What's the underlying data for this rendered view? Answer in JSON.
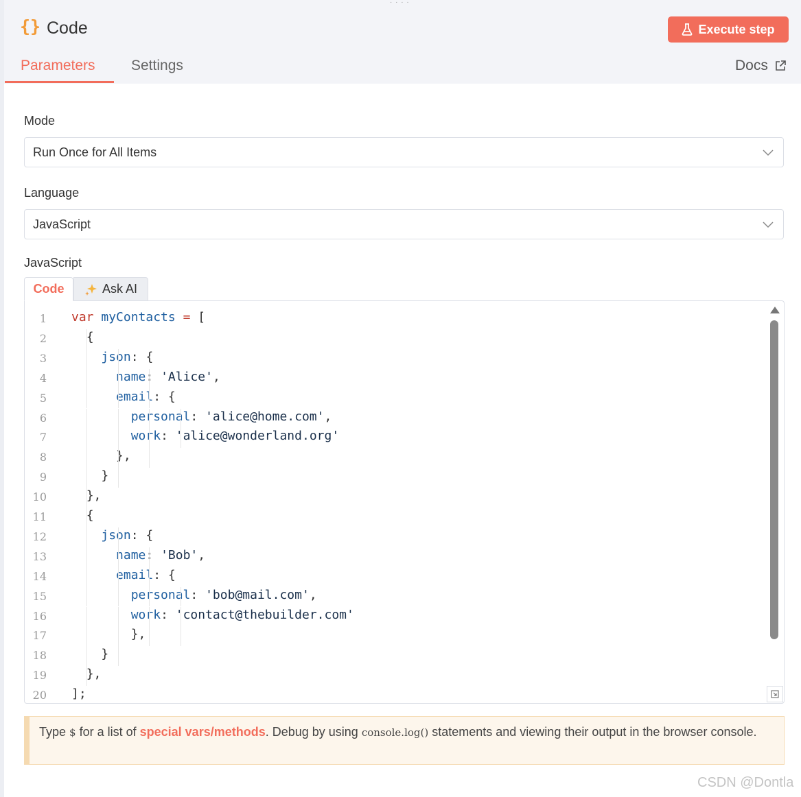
{
  "header": {
    "icon": "braces-icon",
    "title": "Code",
    "execute_label": "Execute step",
    "tabs": [
      {
        "label": "Parameters",
        "active": true
      },
      {
        "label": "Settings",
        "active": false
      }
    ],
    "docs_label": "Docs"
  },
  "form": {
    "mode_label": "Mode",
    "mode_value": "Run Once for All Items",
    "language_label": "Language",
    "language_value": "JavaScript",
    "editor_label": "JavaScript",
    "editor_tabs": [
      {
        "label": "Code",
        "active": true
      },
      {
        "label": "Ask AI",
        "active": false
      }
    ]
  },
  "code_lines": [
    {
      "n": "1",
      "text": "var myContacts = ["
    },
    {
      "n": "2",
      "text": "  {"
    },
    {
      "n": "3",
      "text": "    json: {"
    },
    {
      "n": "4",
      "text": "      name: 'Alice',"
    },
    {
      "n": "5",
      "text": "      email: {"
    },
    {
      "n": "6",
      "text": "        personal: 'alice@home.com',"
    },
    {
      "n": "7",
      "text": "        work: 'alice@wonderland.org'"
    },
    {
      "n": "8",
      "text": "      },"
    },
    {
      "n": "9",
      "text": "    }"
    },
    {
      "n": "10",
      "text": "  },"
    },
    {
      "n": "11",
      "text": "  {"
    },
    {
      "n": "12",
      "text": "    json: {"
    },
    {
      "n": "13",
      "text": "      name: 'Bob',"
    },
    {
      "n": "14",
      "text": "      email: {"
    },
    {
      "n": "15",
      "text": "        personal: 'bob@mail.com',"
    },
    {
      "n": "16",
      "text": "        work: 'contact@thebuilder.com'"
    },
    {
      "n": "17",
      "text": "        },"
    },
    {
      "n": "18",
      "text": "    }"
    },
    {
      "n": "19",
      "text": "  },"
    },
    {
      "n": "20",
      "text": "];"
    }
  ],
  "notice": {
    "part1": "Type ",
    "dollar": "$",
    "part2": " for a list of ",
    "link": "special vars/methods",
    "part3": ". Debug by using ",
    "code": "console.log()",
    "part4": " statements and viewing their output in the browser console."
  },
  "watermark": "CSDN @Dontla",
  "colors": {
    "accent": "#f26d5b",
    "icon": "#f29b38",
    "notice_bg": "#fdf6ec"
  }
}
